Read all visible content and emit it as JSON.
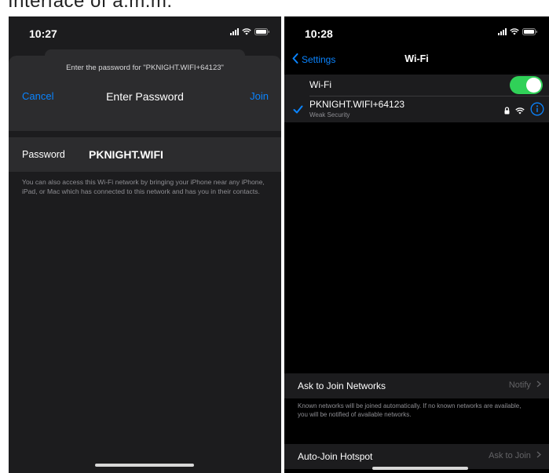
{
  "caption": "Interface of a.m.m.",
  "left_phone": {
    "status_time": "10:27",
    "prompt": "Enter the password for \"PKNIGHT.WIFI+64123\"",
    "cancel_label": "Cancel",
    "title": "Enter Password",
    "join_label": "Join",
    "password_label": "Password",
    "password_value": "PKNIGHT.WIFI",
    "footnote": "You can also access this Wi-Fi network by bringing your iPhone near any iPhone, iPad, or Mac which has connected to this network and has you in their contacts."
  },
  "right_phone": {
    "status_time": "10:28",
    "back_label": "Settings",
    "title": "Wi-Fi",
    "wifi_label": "Wi-Fi",
    "wifi_on": true,
    "network_name": "PKNIGHT.WIFI+64123",
    "network_security": "Weak Security",
    "ask_label": "Ask to Join Networks",
    "ask_value": "Notify",
    "ask_note": "Known networks will be joined automatically. If no known networks are available, you will be notified of available networks.",
    "hotspot_label": "Auto-Join Hotspot",
    "hotspot_value": "Ask to Join"
  },
  "colors": {
    "accent": "#0a84ff",
    "toggle_on": "#30d158",
    "background": "#000000",
    "cell": "#1c1c1e"
  },
  "icons": [
    "cellular-signal-icon",
    "wifi-icon",
    "battery-icon",
    "chevron-left-icon",
    "checkmark-icon",
    "lock-icon",
    "info-icon",
    "chevron-right-icon"
  ]
}
